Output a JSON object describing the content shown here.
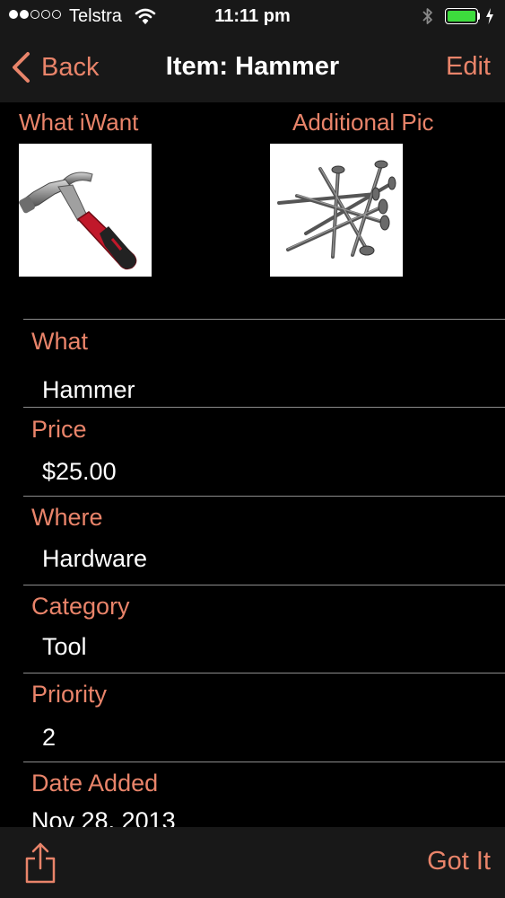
{
  "status_bar": {
    "signal_bars_filled": 2,
    "signal_bars_total": 5,
    "carrier": "Telstra",
    "time": "11:11 pm",
    "battery_level": 1.0,
    "charging": true,
    "battery_color": "#3ddc3d"
  },
  "nav": {
    "back_label": "Back",
    "title": "Item: Hammer",
    "edit_label": "Edit"
  },
  "pictures": {
    "main_label": "What iWant",
    "main_image": "hammer-photo",
    "additional_label": "Additional Pic",
    "additional_image": "nails-photo"
  },
  "fields": [
    {
      "label": "What",
      "value": "Hammer"
    },
    {
      "label": "Price",
      "value": "$25.00"
    },
    {
      "label": "Where",
      "value": "Hardware"
    },
    {
      "label": "Category",
      "value": "Tool"
    },
    {
      "label": "Priority",
      "value": "2"
    },
    {
      "label": "Date Added",
      "value": "Nov 28, 2013"
    }
  ],
  "toolbar": {
    "share_icon": "share-icon",
    "got_it_label": "Got It"
  },
  "colors": {
    "accent": "#e9846a",
    "bar_background": "#181818",
    "background": "#000000"
  }
}
